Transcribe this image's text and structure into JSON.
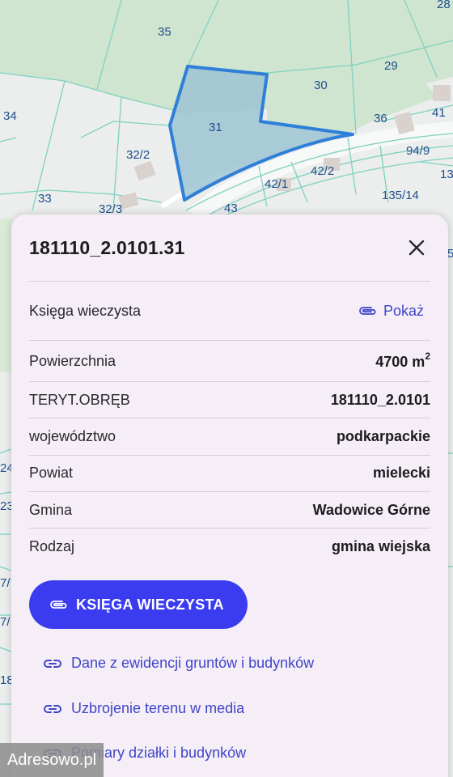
{
  "map": {
    "parcel_labels": [
      "35",
      "28",
      "29",
      "30",
      "31",
      "34",
      "36",
      "41",
      "94/9",
      "32/2",
      "42/2",
      "42/1",
      "13",
      "33",
      "135/14",
      "32/3",
      "43",
      "24",
      "23",
      "7/",
      "7/",
      "18",
      "5"
    ]
  },
  "panel": {
    "title": "181110_2.0101.31",
    "ksiega": {
      "label": "Księga wieczysta",
      "action": "Pokaż"
    },
    "rows": [
      {
        "label": "Powierzchnia",
        "value": "4700 m",
        "sup": "2"
      },
      {
        "label": "TERYT.OBRĘB",
        "value": "181110_2.0101"
      },
      {
        "label": "województwo",
        "value": "podkarpackie"
      },
      {
        "label": "Powiat",
        "value": "mielecki"
      },
      {
        "label": "Gmina",
        "value": "Wadowice Górne"
      },
      {
        "label": "Rodzaj",
        "value": "gmina wiejska"
      }
    ],
    "primary_button": "KSIĘGA WIECZYSTA",
    "links": [
      "Dane z ewidencji gruntów i budynków",
      "Uzbrojenie terenu w media",
      "Pomiary działki i budynków"
    ]
  },
  "watermark": "Adresowo.pl",
  "colors": {
    "accent": "#3b3cf0",
    "link": "#3f46c9",
    "parcel_highlight": "#2f7fd8"
  }
}
